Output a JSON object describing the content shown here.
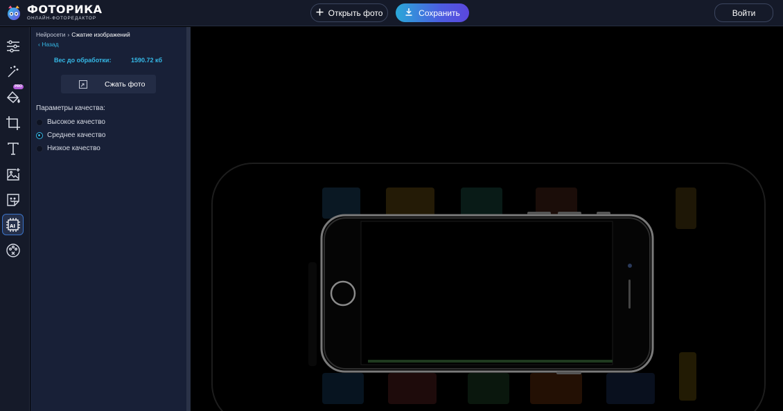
{
  "header": {
    "logo_name": "ФОТОРИКА",
    "logo_sub": "ОНЛАЙН-ФОТОРЕДАКТОР",
    "open_label": "Открыть фото",
    "save_label": "Сохранить",
    "login_label": "Войти"
  },
  "rail": {
    "tools": [
      {
        "name": "adjustments-icon"
      },
      {
        "name": "magic-wand-icon"
      },
      {
        "name": "paint-bucket-icon",
        "badge": "PRO"
      },
      {
        "name": "crop-icon"
      },
      {
        "name": "text-icon"
      },
      {
        "name": "add-image-icon"
      },
      {
        "name": "sticker-icon"
      },
      {
        "name": "ai-chip-icon",
        "active": true
      },
      {
        "name": "palette-icon"
      }
    ],
    "pro_badge": "PRO"
  },
  "panel": {
    "breadcrumb_parent": "Нейросети",
    "breadcrumb_separator": "›",
    "breadcrumb_current": "Сжатие изображений",
    "back_label": "‹ Назад",
    "weight_label": "Вес до обработки:",
    "weight_value": "1590.72 кб",
    "compress_button": "Сжать фото",
    "quality_title": "Параметры качества:",
    "quality_options": [
      {
        "label": "Высокое качество",
        "checked": false
      },
      {
        "label": "Среднее качество",
        "checked": true
      },
      {
        "label": "Низкое качество",
        "checked": false
      }
    ]
  },
  "colors": {
    "accent": "#35b8e6",
    "header_bg": "#151a29",
    "panel_bg": "#182037",
    "save_gradient_start": "#2aa8d8",
    "save_gradient_end": "#5b47de"
  }
}
